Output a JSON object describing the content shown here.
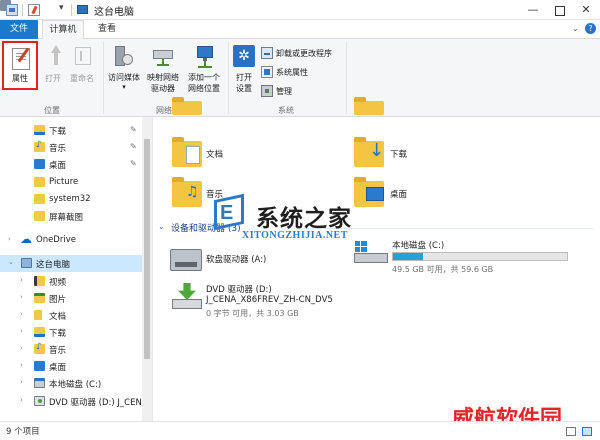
{
  "window": {
    "title": "这台电脑",
    "controls": {
      "minimize": "—",
      "close": "✕"
    }
  },
  "menu": {
    "file_tab": "文件",
    "tabs": [
      "计算机",
      "查看"
    ]
  },
  "ribbon": {
    "location_group": {
      "label": "位置",
      "properties": "属性",
      "open": "打开",
      "rename": "重命名"
    },
    "network_group": {
      "label": "网络",
      "access_media": "访问媒体",
      "map_drive_line1": "映射网络",
      "map_drive_line2": "驱动器",
      "add_location_line1": "添加一个",
      "add_location_line2": "网络位置"
    },
    "system_group": {
      "label": "系统",
      "open_settings_line1": "打开",
      "open_settings_line2": "设置",
      "uninstall": "卸载或更改程序",
      "system_properties": "系统属性",
      "manage": "管理"
    }
  },
  "nav": {
    "quick_access": [
      {
        "label": "下载",
        "icon": "download-folder-icon",
        "pinned": true
      },
      {
        "label": "音乐",
        "icon": "music-folder-icon",
        "pinned": true
      },
      {
        "label": "桌面",
        "icon": "desktop-folder-icon",
        "pinned": true
      },
      {
        "label": "Picture",
        "icon": "folder-icon",
        "pinned": false
      },
      {
        "label": "system32",
        "icon": "folder-icon",
        "pinned": false
      },
      {
        "label": "屏幕截图",
        "icon": "folder-icon",
        "pinned": false
      }
    ],
    "onedrive": "OneDrive",
    "this_pc": "这台电脑",
    "this_pc_children": [
      {
        "label": "视频",
        "icon": "video-folder-icon"
      },
      {
        "label": "图片",
        "icon": "picture-folder-icon"
      },
      {
        "label": "文档",
        "icon": "documents-folder-icon"
      },
      {
        "label": "下载",
        "icon": "download-folder-icon"
      },
      {
        "label": "音乐",
        "icon": "music-folder-icon"
      },
      {
        "label": "桌面",
        "icon": "desktop-folder-icon"
      },
      {
        "label": "本地磁盘 (C:)",
        "icon": "local-disk-icon"
      },
      {
        "label": "DVD 驱动器 (D:) J_CEN",
        "icon": "dvd-drive-icon"
      }
    ]
  },
  "content": {
    "folders": [
      {
        "label": "文档",
        "icon": "documents-folder-icon"
      },
      {
        "label": "下载",
        "icon": "download-folder-icon"
      },
      {
        "label": "音乐",
        "icon": "music-folder-icon"
      },
      {
        "label": "桌面",
        "icon": "desktop-folder-icon"
      }
    ],
    "devices_header": "设备和驱动器 (3)",
    "devices": {
      "floppy": {
        "label": "软盘驱动器 (A:)"
      },
      "local_disk": {
        "label": "本地磁盘 (C:)",
        "space": "49.5 GB 可用，共 59.6 GB",
        "used_fraction": 0.17
      },
      "dvd": {
        "label_line1": "DVD 驱动器 (D:)",
        "label_line2": "J_CENA_X86FREV_ZH-CN_DV5",
        "space": "0 字节 可用，共 3.03 GB"
      }
    }
  },
  "watermarks": {
    "logo_letter": "E",
    "site_cn": "系统之家",
    "site_en": "XITONGZHIJIA.NET",
    "bottom": "威航软件园"
  },
  "status": {
    "item_count": "9 个项目"
  },
  "colors": {
    "accent": "#1979ca",
    "selection": "#cce8ff",
    "highlight_border": "#e2231a",
    "capacity_fill": "#26a0da"
  }
}
